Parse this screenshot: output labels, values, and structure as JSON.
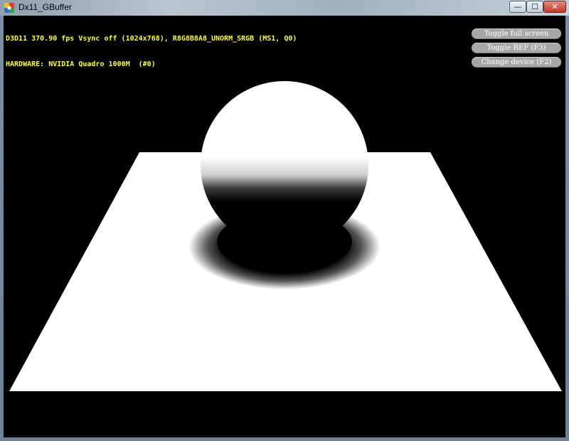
{
  "window": {
    "title": "Dx11_GBuffer",
    "icon": "directx-app-icon",
    "controls": {
      "minimize": "—",
      "maximize": "☐",
      "close": "✕"
    }
  },
  "hud": {
    "line1": "D3D11 370.90 fps Vsync off (1024x768), R8G8B8A8_UNORM_SRGB (MS1, Q0)",
    "line2": "HARDWARE: NVIDIA Quadro 1000M  (#0)",
    "color": "#ffff3c"
  },
  "buttons": {
    "toggle_fullscreen": "Toggle full screen",
    "toggle_ref": "Toggle REF (F3)",
    "change_device": "Change device (F2)"
  },
  "scene": {
    "background": "#000000",
    "objects": [
      "white-ground-plane",
      "white-sphere",
      "contact-shadow"
    ]
  }
}
